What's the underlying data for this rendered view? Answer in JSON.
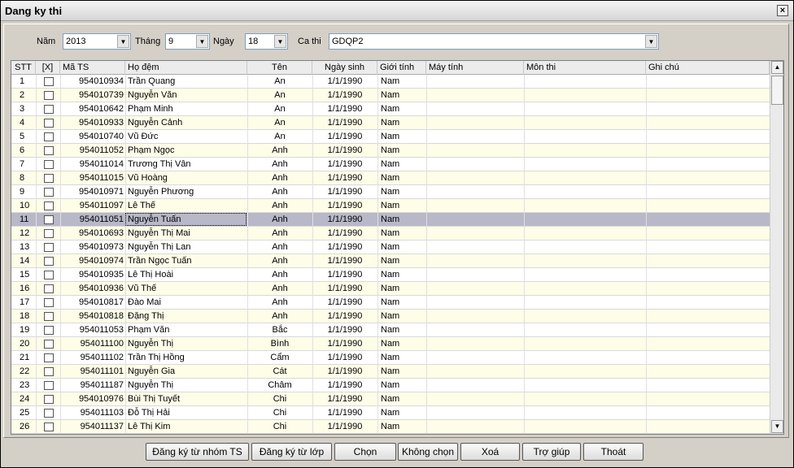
{
  "window": {
    "title": "Dang ky thi",
    "close_icon": "×"
  },
  "filters": {
    "nam_label": "Năm",
    "nam_value": "2013",
    "thang_label": "Tháng",
    "thang_value": "9",
    "ngay_label": "Ngày",
    "ngay_value": "18",
    "cathi_label": "Ca thi",
    "cathi_value": "GDQP2"
  },
  "table": {
    "columns": [
      "STT",
      "[X]",
      "Mã TS",
      "Họ đệm",
      "Tên",
      "Ngày sinh",
      "Giới tính",
      "Máy tính",
      "Môn thi",
      "Ghi chú"
    ],
    "rows": [
      {
        "stt": "1",
        "ma": "954010934",
        "ho": "Trần Quang",
        "ten": "An",
        "ns": "1/1/1990",
        "gt": "Nam"
      },
      {
        "stt": "2",
        "ma": "954010739",
        "ho": "Nguyễn Văn",
        "ten": "An",
        "ns": "1/1/1990",
        "gt": "Nam"
      },
      {
        "stt": "3",
        "ma": "954010642",
        "ho": "Phạm Minh",
        "ten": "An",
        "ns": "1/1/1990",
        "gt": "Nam"
      },
      {
        "stt": "4",
        "ma": "954010933",
        "ho": "Nguyễn Cảnh",
        "ten": "An",
        "ns": "1/1/1990",
        "gt": "Nam"
      },
      {
        "stt": "5",
        "ma": "954010740",
        "ho": "Vũ Đức",
        "ten": "An",
        "ns": "1/1/1990",
        "gt": "Nam"
      },
      {
        "stt": "6",
        "ma": "954011052",
        "ho": "Phạm Ngọc",
        "ten": "Anh",
        "ns": "1/1/1990",
        "gt": "Nam"
      },
      {
        "stt": "7",
        "ma": "954011014",
        "ho": "Trương Thị Vân",
        "ten": "Anh",
        "ns": "1/1/1990",
        "gt": "Nam"
      },
      {
        "stt": "8",
        "ma": "954011015",
        "ho": "Vũ Hoàng",
        "ten": "Anh",
        "ns": "1/1/1990",
        "gt": "Nam"
      },
      {
        "stt": "9",
        "ma": "954010971",
        "ho": "Nguyễn Phương",
        "ten": "Anh",
        "ns": "1/1/1990",
        "gt": "Nam"
      },
      {
        "stt": "10",
        "ma": "954011097",
        "ho": "Lê Thế",
        "ten": "Anh",
        "ns": "1/1/1990",
        "gt": "Nam"
      },
      {
        "stt": "11",
        "ma": "954011051",
        "ho": "Nguyễn Tuấn",
        "ten": "Anh",
        "ns": "1/1/1990",
        "gt": "Nam"
      },
      {
        "stt": "12",
        "ma": "954010693",
        "ho": "Nguyễn Thị Mai",
        "ten": "Anh",
        "ns": "1/1/1990",
        "gt": "Nam"
      },
      {
        "stt": "13",
        "ma": "954010973",
        "ho": "Nguyễn Thị Lan",
        "ten": "Anh",
        "ns": "1/1/1990",
        "gt": "Nam"
      },
      {
        "stt": "14",
        "ma": "954010974",
        "ho": "Trần Ngọc Tuấn",
        "ten": "Anh",
        "ns": "1/1/1990",
        "gt": "Nam"
      },
      {
        "stt": "15",
        "ma": "954010935",
        "ho": "Lê Thị Hoài",
        "ten": "Anh",
        "ns": "1/1/1990",
        "gt": "Nam"
      },
      {
        "stt": "16",
        "ma": "954010936",
        "ho": "Vũ Thế",
        "ten": "Anh",
        "ns": "1/1/1990",
        "gt": "Nam"
      },
      {
        "stt": "17",
        "ma": "954010817",
        "ho": "Đào Mai",
        "ten": "Anh",
        "ns": "1/1/1990",
        "gt": "Nam"
      },
      {
        "stt": "18",
        "ma": "954010818",
        "ho": "Đặng Thị",
        "ten": "Anh",
        "ns": "1/1/1990",
        "gt": "Nam"
      },
      {
        "stt": "19",
        "ma": "954011053",
        "ho": "Phạm Văn",
        "ten": "Bắc",
        "ns": "1/1/1990",
        "gt": "Nam"
      },
      {
        "stt": "20",
        "ma": "954011100",
        "ho": "Nguyễn Thị",
        "ten": "Bình",
        "ns": "1/1/1990",
        "gt": "Nam"
      },
      {
        "stt": "21",
        "ma": "954011102",
        "ho": "Trần Thị Hồng",
        "ten": "Cẩm",
        "ns": "1/1/1990",
        "gt": "Nam"
      },
      {
        "stt": "22",
        "ma": "954011101",
        "ho": "Nguyễn Gia",
        "ten": "Cát",
        "ns": "1/1/1990",
        "gt": "Nam"
      },
      {
        "stt": "23",
        "ma": "954011187",
        "ho": "Nguyễn Thị",
        "ten": "Châm",
        "ns": "1/1/1990",
        "gt": "Nam"
      },
      {
        "stt": "24",
        "ma": "954010976",
        "ho": "Bùi Thị Tuyết",
        "ten": "Chi",
        "ns": "1/1/1990",
        "gt": "Nam"
      },
      {
        "stt": "25",
        "ma": "954011103",
        "ho": "Đỗ Thị Hải",
        "ten": "Chi",
        "ns": "1/1/1990",
        "gt": "Nam"
      },
      {
        "stt": "26",
        "ma": "954011137",
        "ho": "Lê Thị Kim",
        "ten": "Chi",
        "ns": "1/1/1990",
        "gt": "Nam"
      }
    ]
  },
  "buttons": {
    "dk_nhom": "Đăng ký từ nhóm TS",
    "dk_lop": "Đăng ký từ lớp",
    "chon": "Chọn",
    "khong_chon": "Không chọn",
    "xoa": "Xoá",
    "tro_giup": "Trợ giúp",
    "thoat": "Thoát"
  }
}
